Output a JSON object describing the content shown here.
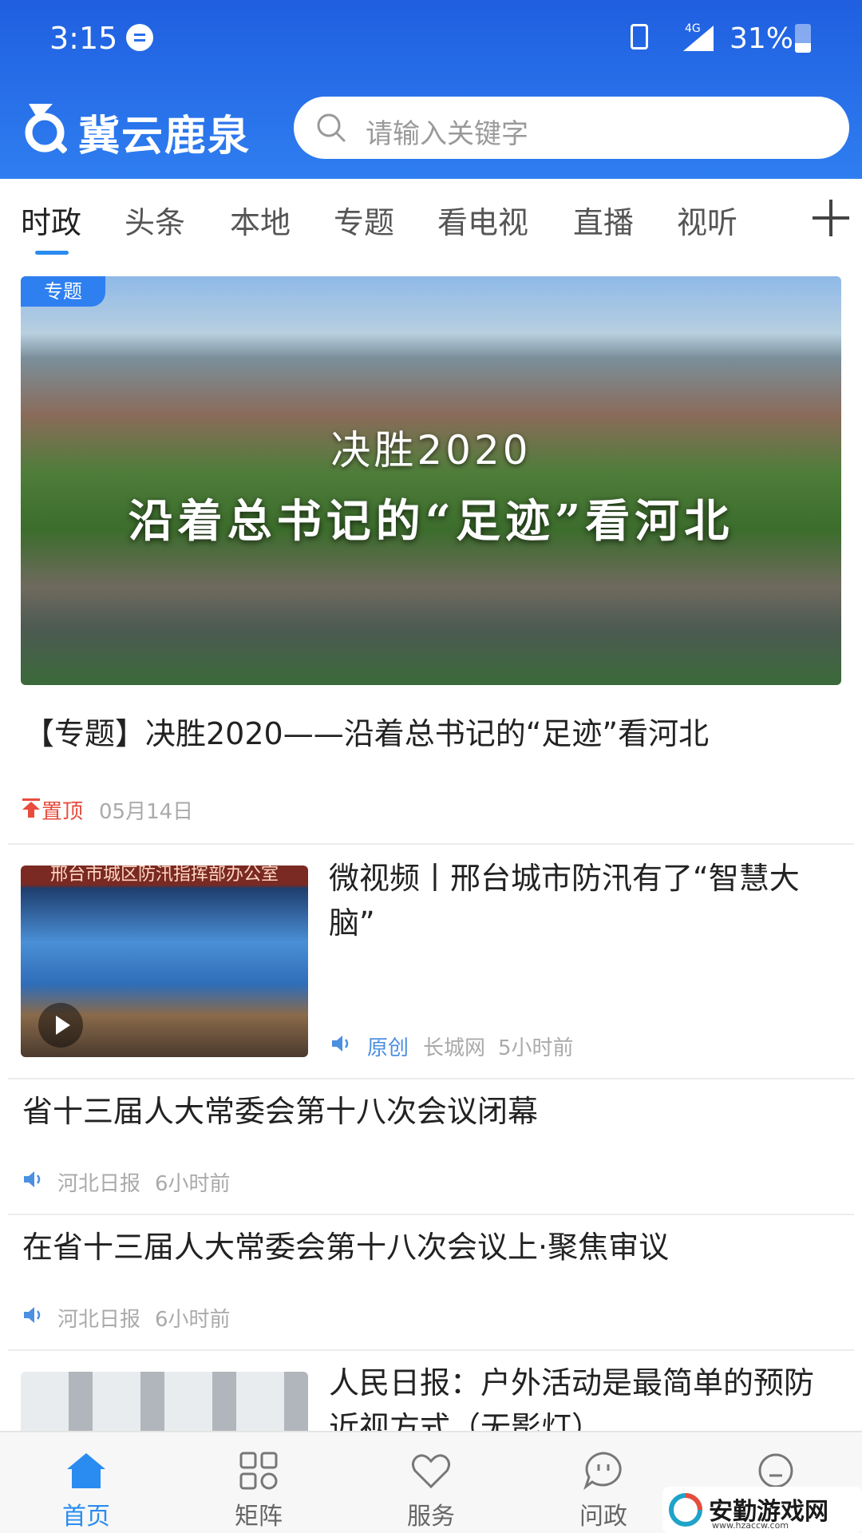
{
  "status_bar": {
    "time": "3:15",
    "network": "4G",
    "battery": "31%"
  },
  "header": {
    "app_name": "冀云鹿泉",
    "search_placeholder": "请输入关键字"
  },
  "tabs": [
    {
      "label": "时政",
      "active": true
    },
    {
      "label": "头条"
    },
    {
      "label": "本地"
    },
    {
      "label": "专题"
    },
    {
      "label": "看电视"
    },
    {
      "label": "直播"
    },
    {
      "label": "视听"
    }
  ],
  "feature": {
    "badge": "专题",
    "image_subtitle": "决胜2020",
    "image_title": "沿着总书记的“足迹”看河北",
    "title": "【专题】决胜2020——沿着总书记的“足迹”看河北",
    "pin_label": "置顶",
    "date": "05月14日"
  },
  "articles": [
    {
      "title": "微视频丨邢台城市防汛有了“智慧大脑”",
      "thumb_caption": "邢台市城区防汛指挥部办公室",
      "tag": "原创",
      "source": "长城网",
      "time": "5小时前"
    },
    {
      "title": "省十三届人大常委会第十八次会议闭幕",
      "source": "河北日报",
      "time": "6小时前"
    },
    {
      "title": "在省十三届人大常委会第十八次会议上·聚焦审议",
      "source": "河北日报",
      "time": "6小时前"
    },
    {
      "title": "人民日报：户外活动是最简单的预防近视方式（无影灯）"
    }
  ],
  "bottom_nav": [
    {
      "label": "首页",
      "icon": "home-icon",
      "active": true
    },
    {
      "label": "矩阵",
      "icon": "grid-icon"
    },
    {
      "label": "服务",
      "icon": "heart-icon"
    },
    {
      "label": "问政",
      "icon": "chat-icon"
    }
  ],
  "watermark": {
    "text": "安勤游戏网",
    "url": "www.hzaccw.com"
  },
  "colors": {
    "header_blue": "#2a6ee8",
    "accent_blue": "#2a8cf0",
    "pin_red": "#e84c3d"
  }
}
